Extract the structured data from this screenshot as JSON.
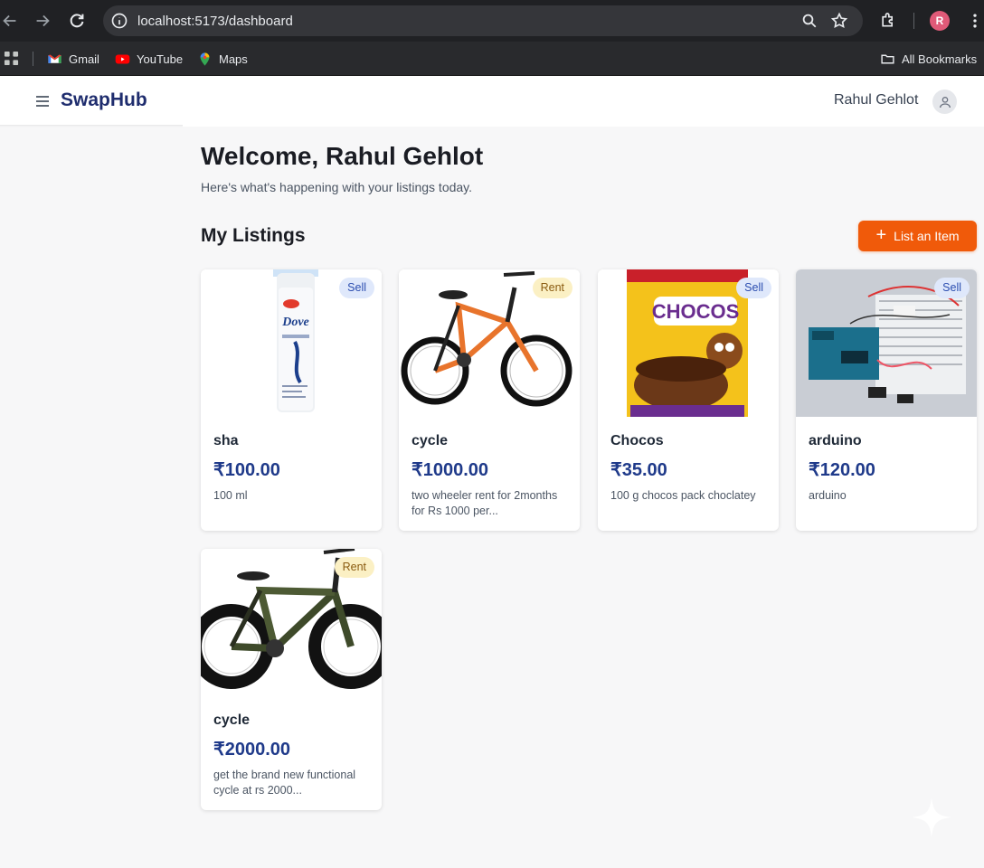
{
  "browser": {
    "url": "localhost:5173/dashboard",
    "profile_initial": "R",
    "bookmarks": [
      {
        "label": "Gmail",
        "icon": "gmail-icon"
      },
      {
        "label": "YouTube",
        "icon": "youtube-icon"
      },
      {
        "label": "Maps",
        "icon": "maps-icon"
      }
    ],
    "all_bookmarks_label": "All Bookmarks"
  },
  "header": {
    "brand": "SwapHub",
    "user_name": "Rahul Gehlot"
  },
  "main": {
    "welcome": "Welcome, Rahul Gehlot",
    "subtitle": "Here's what's happening with your listings today.",
    "section_title": "My Listings",
    "list_button": "List an Item"
  },
  "listings": [
    {
      "title": "sha",
      "price": "₹100.00",
      "description": "100 ml",
      "badge": "Sell",
      "image": "shampoo-bottle"
    },
    {
      "title": "cycle",
      "price": "₹1000.00",
      "description": "two wheeler rent for 2months for Rs 1000 per...",
      "badge": "Rent",
      "image": "orange-bicycle"
    },
    {
      "title": "Chocos",
      "price": "₹35.00",
      "description": "100 g chocos pack choclatey",
      "badge": "Sell",
      "image": "cereal-pack"
    },
    {
      "title": "arduino",
      "price": "₹120.00",
      "description": "arduino",
      "badge": "Sell",
      "image": "arduino-board"
    },
    {
      "title": "cycle",
      "price": "₹2000.00",
      "description": "get the brand new functional cycle at rs 2000...",
      "badge": "Rent",
      "image": "fat-tire-bicycle"
    }
  ],
  "colors": {
    "brand": "#1f2d6e",
    "accent": "#f05a0a",
    "price": "#1f3a8a",
    "sell_badge": "#dfe8fb",
    "rent_badge": "#fbf0c4"
  }
}
